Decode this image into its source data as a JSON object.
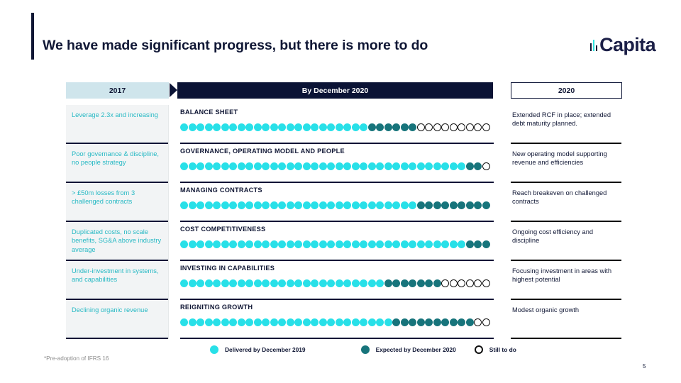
{
  "slide": {
    "title": "We have made significant progress, but there is more to do",
    "footnote": "*Pre-adoption of IFRS 16",
    "page_number": "5",
    "brand": {
      "logo_word": "Capita",
      "navy": "#101735",
      "cyan": "#28e0e8",
      "teal": "#17747b",
      "pale_blue": "#cfe5ec"
    }
  },
  "headers": {
    "left": "2017",
    "middle": "By December 2020",
    "right": "2020"
  },
  "rows": [
    {
      "left": "Leverage 2.3x and increasing",
      "title": "BALANCE SHEET",
      "right": "Extended RCF in place; extended debt maturity planned.",
      "delivered": 23,
      "expected": 6,
      "still_to_do": 9
    },
    {
      "left": "Poor governance & discipline, no people strategy",
      "title": "GOVERNANCE, OPERATING MODEL AND PEOPLE",
      "right": "New operating model supporting revenue and efficiencies",
      "delivered": 35,
      "expected": 2,
      "still_to_do": 1
    },
    {
      "left": "> £50m losses from 3 challenged contracts",
      "title": "MANAGING CONTRACTS",
      "right": "Reach breakeven on challenged contracts",
      "delivered": 29,
      "expected": 9,
      "still_to_do": 0
    },
    {
      "left": "Duplicated costs, no scale benefits, SG&A above industry average",
      "title": "COST COMPETITIVENESS",
      "right": "Ongoing cost efficiency and discipline",
      "delivered": 35,
      "expected": 3,
      "still_to_do": 0
    },
    {
      "left": "Under-investment in systems, and capabilities",
      "title": "INVESTING IN CAPABILITIES",
      "right": "Focusing investment in areas with highest potential",
      "delivered": 25,
      "expected": 7,
      "still_to_do": 6
    },
    {
      "left": "Declining organic revenue",
      "title": "REIGNITING GROWTH",
      "right": "Modest organic growth",
      "delivered": 26,
      "expected": 10,
      "still_to_do": 2
    }
  ],
  "legend": [
    {
      "key": "d",
      "label": "Delivered by December 2019"
    },
    {
      "key": "e",
      "label": "Expected by December 2020"
    },
    {
      "key": "s",
      "label": "Still to do"
    }
  ],
  "chart_data": {
    "type": "bar",
    "title": "Progress by workstream (dot-scale, 38 units per row)",
    "categories": [
      "BALANCE SHEET",
      "GOVERNANCE, OPERATING MODEL AND PEOPLE",
      "MANAGING CONTRACTS",
      "COST COMPETITIVENESS",
      "INVESTING IN CAPABILITIES",
      "REIGNITING GROWTH"
    ],
    "series": [
      {
        "name": "Delivered by December 2019",
        "color": "#28e0e8",
        "values": [
          23,
          35,
          29,
          35,
          25,
          26
        ]
      },
      {
        "name": "Expected by December 2020",
        "color": "#17747b",
        "values": [
          6,
          2,
          9,
          3,
          7,
          10
        ]
      },
      {
        "name": "Still to do",
        "color": "#ffffff",
        "values": [
          9,
          1,
          0,
          0,
          6,
          2
        ]
      }
    ],
    "xlabel": "",
    "ylabel": "",
    "legend_position": "bottom",
    "grid": false,
    "stacked": true
  }
}
